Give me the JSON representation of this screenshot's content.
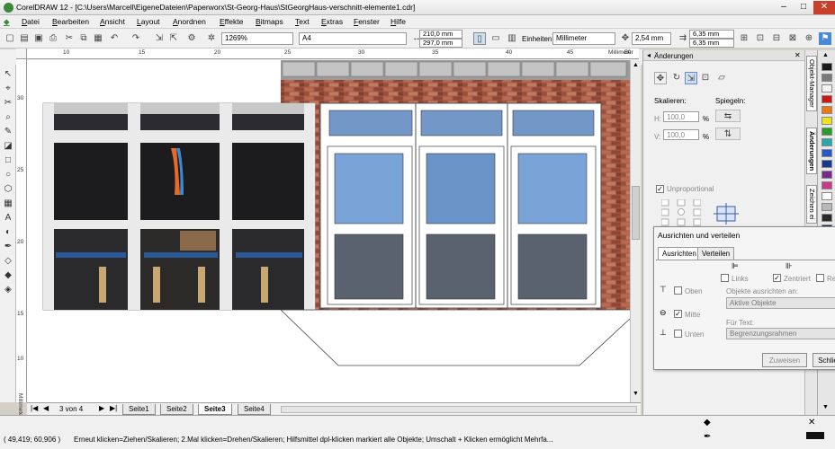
{
  "window": {
    "title": "CorelDRAW 12 - [C:\\Users\\Marcell\\EigeneDateien\\Paperworx\\St-Georg-Haus\\StGeorgHaus-verschnitt-elemente1.cdr]"
  },
  "menu": [
    "Datei",
    "Bearbeiten",
    "Ansicht",
    "Layout",
    "Anordnen",
    "Effekte",
    "Bitmaps",
    "Text",
    "Extras",
    "Fenster",
    "Hilfe"
  ],
  "toolbar": {
    "zoom": "1269%",
    "paper_size": "A4",
    "width": "210,0 mm",
    "height": "297,0 mm",
    "units_label": "Einheiten:",
    "units_value": "Millimeter",
    "nudge": "2,54 mm",
    "dup_x": "6,35 mm",
    "dup_y": "6,35 mm"
  },
  "ruler": {
    "h_ticks": [
      "10",
      "15",
      "20",
      "25",
      "30",
      "35",
      "40",
      "45",
      "50"
    ],
    "h_unit": "Millimeter",
    "v_ticks": [
      "30",
      "25",
      "20",
      "15",
      "10",
      "5"
    ],
    "v_unit": "Millimeter"
  },
  "pages": {
    "counter": "3 von 4",
    "tabs": [
      "Seite1",
      "Seite2",
      "Seite3",
      "Seite4"
    ],
    "active": "Seite3"
  },
  "docker": {
    "header": "Änderungen",
    "scale_label": "Skalieren:",
    "mirror_label": "Spiegeln:",
    "h_label": "H:",
    "h_value": "100,0",
    "v_label": "V:",
    "v_value": "100,0",
    "percent": "%",
    "unproportional": "Unproportional",
    "tabs": [
      "Objekt-Manager",
      "Änderungen",
      "Zeichen ei"
    ]
  },
  "dialog": {
    "title": "Ausrichten und verteilen",
    "tabs": [
      "Ausrichten",
      "Verteilen"
    ],
    "left": "Links",
    "centered": "Zentriert",
    "right": "Re",
    "top": "Oben",
    "middle": "Mitte",
    "bottom": "Unten",
    "align_to_label": "Objekte ausrichten an:",
    "align_to_value": "Aktive Objekte",
    "for_text_label": "Für Text:",
    "for_text_value": "Begrenzungsrahmen",
    "apply": "Zuweisen",
    "close": "Schlie"
  },
  "status": {
    "coords": "( 49,419; 60,906 )",
    "message": "Erneut klicken=Ziehen/Skalieren; 2.Mal klicken=Drehen/Skalieren; Hilfsmittel dpl-klicken markiert alle Objekte; Umschalt + Klicken ermöglicht Mehrfa..."
  },
  "palette": [
    "#1a1a1a",
    "#7a7a7a",
    "#f5f5f5",
    "#c81818",
    "#e87818",
    "#f0e020",
    "#2a9a2a",
    "#28a8a8",
    "#2858c8",
    "#183888",
    "#7a2a8a",
    "#c83a8a",
    "#ffffff",
    "#b8b8b8",
    "#2a2a2a",
    "#14305a"
  ],
  "colors": {
    "brick": "#9a4a3a",
    "glass_blue": "#7aa0d0",
    "glass_dark": "#5a6068",
    "frame": "#e8e8e8"
  }
}
